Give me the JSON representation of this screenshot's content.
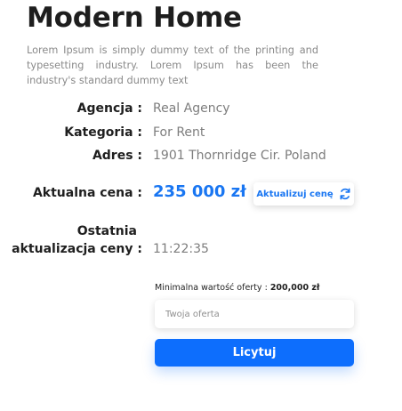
{
  "title": "Modern Home",
  "description": "Lorem Ipsum is simply dummy text of the printing and typesetting industry. Lorem Ipsum has been the industry's standard dummy text",
  "details": {
    "agency_label": "Agencja :",
    "agency_value": "Real Agency",
    "category_label": "Kategoria :",
    "category_value": "For Rent",
    "address_label": "Adres :",
    "address_value": "1901 Thornridge Cir. Poland"
  },
  "price": {
    "label": "Aktualna cena :",
    "value": "235 000 zł",
    "refresh_label": "Aktualizuj cenę",
    "refresh_icon": "refresh-icon"
  },
  "update": {
    "label_line1": "Ostatnia",
    "label_line2": "aktualizacja ceny :",
    "value": "11:22:35"
  },
  "offer": {
    "min_label": "Minimalna wartość oferty :",
    "min_value": "200,000 zł",
    "placeholder": "Twoja oferta",
    "submit_label": "Licytuj"
  },
  "colors": {
    "accent": "#0d6efd",
    "price": "#1976f2"
  }
}
